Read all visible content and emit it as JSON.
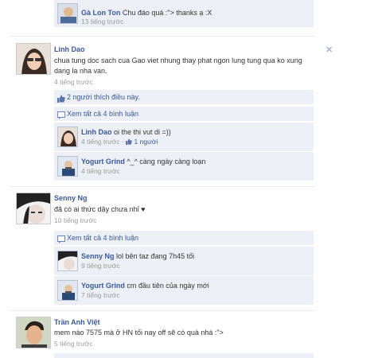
{
  "top_comment": {
    "name": "Gà Lon Ton",
    "text": "Chu đáo quá :\"> thanks ạ :X",
    "time": "13 tiếng trước"
  },
  "posts": [
    {
      "name": "Linh Dao",
      "text": "chua tung doc sach cua Gao viet nhung thay phat ngon lung tung qua ko xung dang la nha van.",
      "time": "4 tiếng trước",
      "likes": "2 người thích điều này.",
      "view_all": "Xem tất cả 4 bình luận",
      "comments": [
        {
          "name": "Linh Dao",
          "text": "oi the thi vut di =))",
          "time": "4 tiếng trước",
          "sep": " · ",
          "like_count": "1 người"
        },
        {
          "name": "Yogurt Grind",
          "text": "^_^ càng ngày càng loạn",
          "time": "4 tiếng trước"
        }
      ]
    },
    {
      "name": "Senny Ng",
      "text": "đã có ai thức dậy chưa nhỉ ♥",
      "time": "10 tiếng trước",
      "view_all": "Xem tất cả 4 bình luận",
      "comments": [
        {
          "name": "Senny Ng",
          "text": "lol bên taz đang 7h45 tối",
          "time": "9 tiếng trước"
        },
        {
          "name": "Yogurt Grind",
          "text": "cm đầu tiên của ngày mới",
          "time": "7 tiếng trước"
        }
      ]
    },
    {
      "name": "Trần Anh Việt",
      "text": "mem nào 7575 mà ở HN tối nay off sẽ có quà nhá :\">",
      "time": "5 tiếng trước"
    }
  ],
  "icons": {
    "like": "thumbs-up-icon",
    "comment": "comment-icon",
    "close": "close-icon"
  },
  "colors": {
    "link": "#3b5998",
    "comment_bg": "#eceff5"
  }
}
